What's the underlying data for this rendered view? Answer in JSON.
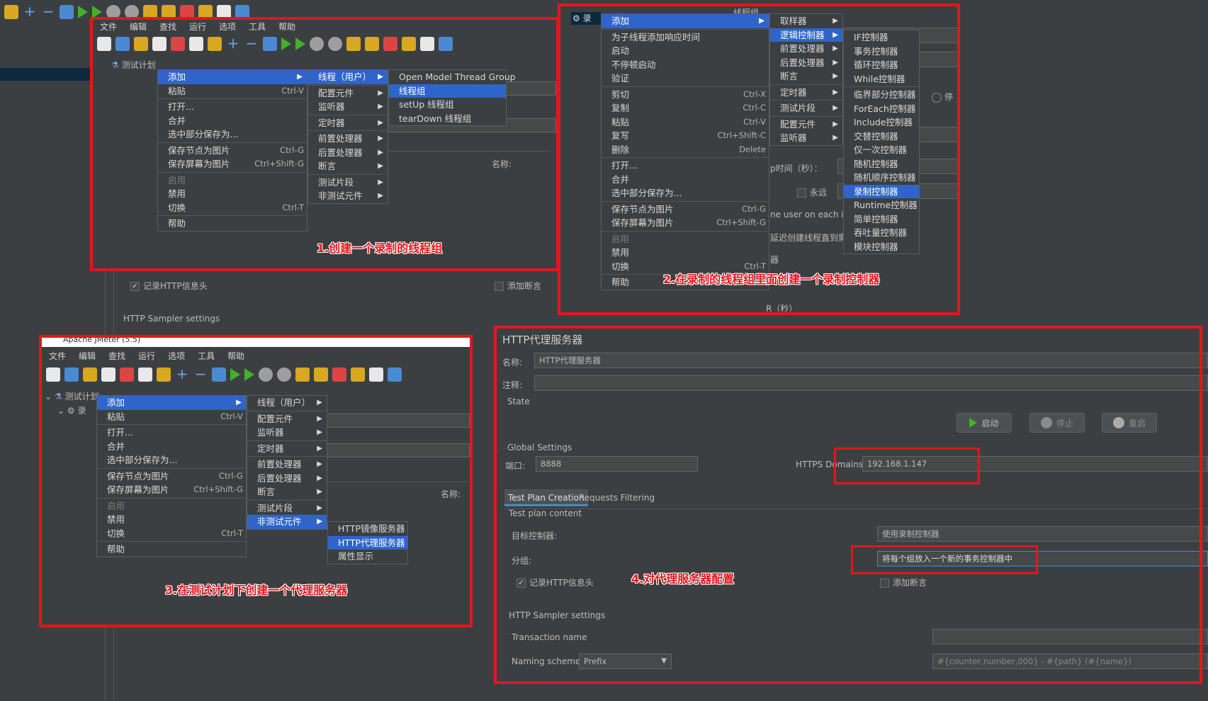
{
  "menu": {
    "file": "文件",
    "edit": "编辑",
    "search": "查找",
    "run": "运行",
    "options": "选项",
    "tools": "工具",
    "help": "帮助"
  },
  "tree": {
    "test_plan": "测试计划",
    "recording_group": "录"
  },
  "window_title": "Apache JMeter (5.5)",
  "ctx_main": {
    "add": "添加",
    "paste": "粘贴",
    "paste_sc": "Ctrl-V",
    "open": "打开...",
    "merge": "合并",
    "save_selection": "选中部分保存为...",
    "save_node_img": "保存节点为图片",
    "save_node_img_sc": "Ctrl-G",
    "save_screen_img": "保存屏幕为图片",
    "save_screen_img_sc": "Ctrl+Shift-G",
    "enable": "启用",
    "disable": "禁用",
    "toggle": "切换",
    "toggle_sc": "Ctrl-T",
    "help": "帮助"
  },
  "sub_add": {
    "threads": "线程（用户）",
    "config": "配置元件",
    "listener": "监听器",
    "timer": "定时器",
    "pre": "前置处理器",
    "post": "后置处理器",
    "assertion": "断言",
    "fragment": "测试片段",
    "non_test": "非测试元件"
  },
  "sub_threads": {
    "open_model": "Open Model Thread Group",
    "thread_group": "线程组",
    "setup": "setUp 线程组",
    "teardown": "tearDown 线程组"
  },
  "ctx_tg": {
    "add": "添加",
    "add_response_time": "为子线程添加响应时间",
    "start": "启动",
    "start_no_pause": "不停顿启动",
    "validate": "验证",
    "cut": "剪切",
    "cut_sc": "Ctrl-X",
    "copy": "复制",
    "copy_sc": "Ctrl-C",
    "paste": "粘贴",
    "paste_sc": "Ctrl-V",
    "duplicate": "复写",
    "duplicate_sc": "Ctrl+Shift-C",
    "delete": "删除",
    "delete_sc": "Delete",
    "open": "打开...",
    "merge": "合并",
    "save_selection": "选中部分保存为...",
    "save_node_img": "保存节点为图片",
    "save_node_img_sc": "Ctrl-G",
    "save_screen_img": "保存屏幕为图片",
    "save_screen_img_sc": "Ctrl+Shift-G",
    "enable": "启用",
    "disable": "禁用",
    "toggle": "切换",
    "toggle_sc": "Ctrl-T",
    "help": "帮助"
  },
  "sub_tg_add": {
    "sampler": "取样器",
    "logic": "逻辑控制器",
    "pre": "前置处理器",
    "post": "后置处理器",
    "assertion": "断言",
    "timer": "定时器",
    "fragment": "测试片段",
    "config": "配置元件",
    "listener": "监听器"
  },
  "sub_logic": [
    "IF控制器",
    "事务控制器",
    "循环控制器",
    "While控制器",
    "临界部分控制器",
    "ForEach控制器",
    "Include控制器",
    "交替控制器",
    "仅一次控制器",
    "随机控制器",
    "随机顺序控制器",
    "录制控制器",
    "Runtime控制器",
    "简单控制器",
    "吞吐量控制器",
    "模块控制器"
  ],
  "bg_fragments": {
    "tg_title": "线程组",
    "ramp": "p时间（秒）：",
    "forever": "永远",
    "user_each": "ne user on each ite",
    "delay": "延迟创建线程直到需要",
    "scheduler": "器",
    "duration": "R（秒）",
    "stop": "停",
    "name_label": "名称:",
    "record_http": "记录HTTP信息头",
    "add_assert": "添加断言",
    "sampler_settings": "HTTP Sampler settings"
  },
  "sub_non_test": {
    "mirror": "HTTP镜像服务器",
    "proxy": "HTTP代理服务器",
    "props": "属性显示"
  },
  "proxy": {
    "title": "HTTP代理服务器",
    "name_label": "名称:",
    "name_value": "HTTP代理服务器",
    "comment_label": "注释:",
    "state": "State",
    "start": "启动",
    "stop": "停止",
    "restart": "重启",
    "global": "Global Settings",
    "port_label": "端口:",
    "port_value": "8888",
    "https_label": "HTTPS Domains:",
    "https_value": "192.168.1.147",
    "tab_creation": "Test Plan Creation",
    "tab_filter": "Requests Filtering",
    "content": "Test plan content",
    "target_label": "目标控制器:",
    "target_value": "使用录制控制器",
    "group_label": "分组:",
    "group_value": "将每个组放入一个新的事务控制器中",
    "record_http": "记录HTTP信息头",
    "add_assert": "添加断言",
    "sampler_settings": "HTTP Sampler settings",
    "transaction_name": "Transaction name",
    "naming_scheme": "Naming scheme",
    "naming_value": "Prefix",
    "naming_format": "#{counter,number,000} - #{path} (#{name})"
  },
  "annotations": {
    "a1": "1.创建一个录制的线程组",
    "a2": "2.在录制的线程组里面创建一个录制控制器",
    "a3": "3.在测试计划下创建一个代理服务器",
    "a4": "4.对代理服务器配置"
  },
  "colors": {
    "bg": "#3c3f41",
    "selected": "#2f65ca",
    "annotation": "#e8141b"
  }
}
